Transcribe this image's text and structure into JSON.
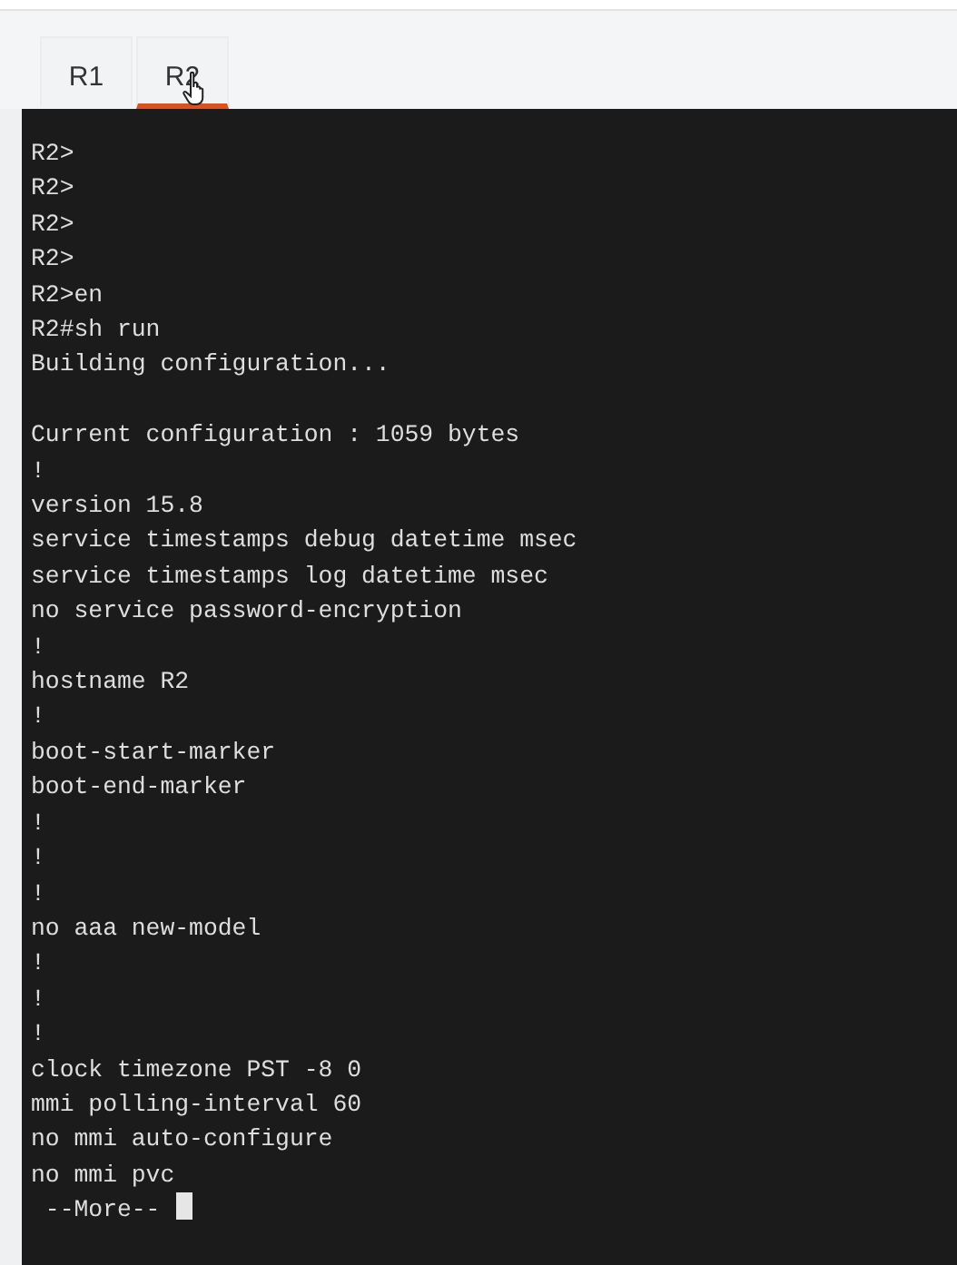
{
  "tabs": [
    {
      "label": "R1",
      "selected": false
    },
    {
      "label": "R2",
      "selected": true
    }
  ],
  "terminal": {
    "lines": [
      {
        "kind": "text",
        "text": "R2>"
      },
      {
        "kind": "text",
        "text": "R2>"
      },
      {
        "kind": "text",
        "text": "R2>"
      },
      {
        "kind": "text",
        "text": "R2>"
      },
      {
        "kind": "text",
        "text": "R2>en"
      },
      {
        "kind": "text",
        "text": "R2#sh run"
      },
      {
        "kind": "text",
        "text": "Building configuration..."
      },
      {
        "kind": "blank"
      },
      {
        "kind": "text",
        "text": "Current configuration : 1059 bytes"
      },
      {
        "kind": "text",
        "text": "!"
      },
      {
        "kind": "text",
        "text": "version 15.8"
      },
      {
        "kind": "text",
        "text": "service timestamps debug datetime msec"
      },
      {
        "kind": "text",
        "text": "service timestamps log datetime msec"
      },
      {
        "kind": "text",
        "text": "no service password-encryption"
      },
      {
        "kind": "text",
        "text": "!"
      },
      {
        "kind": "text",
        "text": "hostname R2"
      },
      {
        "kind": "text",
        "text": "!"
      },
      {
        "kind": "text",
        "text": "boot-start-marker"
      },
      {
        "kind": "text",
        "text": "boot-end-marker"
      },
      {
        "kind": "text",
        "text": "!"
      },
      {
        "kind": "text",
        "text": "!"
      },
      {
        "kind": "text",
        "text": "!"
      },
      {
        "kind": "text",
        "text": "no aaa new-model"
      },
      {
        "kind": "text",
        "text": "!"
      },
      {
        "kind": "text",
        "text": "!"
      },
      {
        "kind": "text",
        "text": "!"
      },
      {
        "kind": "text",
        "text": "clock timezone PST -8 0"
      },
      {
        "kind": "text",
        "text": "mmi polling-interval 60"
      },
      {
        "kind": "text",
        "text": "no mmi auto-configure"
      },
      {
        "kind": "text",
        "text": "no mmi pvc"
      },
      {
        "kind": "prompt",
        "text": " --More-- ",
        "cursor": true
      }
    ]
  }
}
